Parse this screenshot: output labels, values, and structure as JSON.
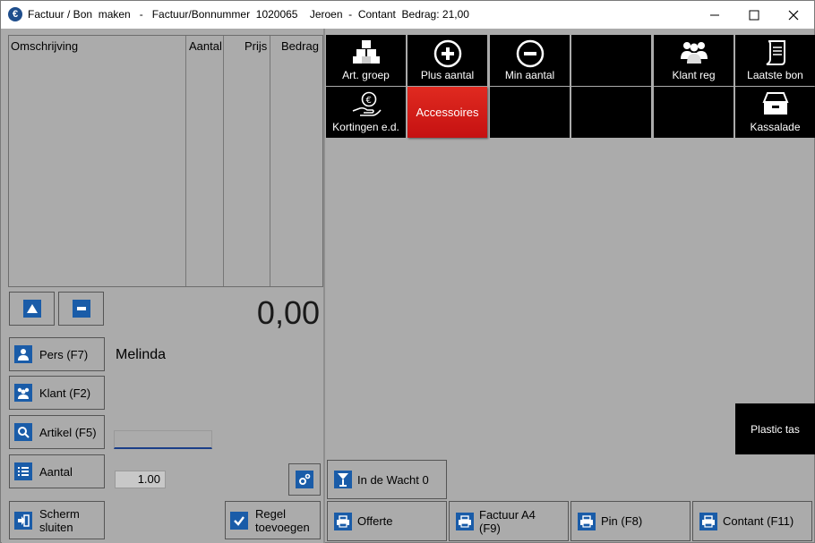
{
  "window": {
    "title": "Factuur / Bon  maken   -   Factuur/Bonnummer  1020065    Jeroen  -  Contant  Bedrag: 21,00"
  },
  "grid": {
    "headers": [
      "Omschrijving",
      "Aantal",
      "Prijs",
      "Bedrag"
    ]
  },
  "total": "0,00",
  "left_buttons": {
    "pers": "Pers (F7)",
    "klant": "Klant (F2)",
    "artikel": "Artikel (F5)",
    "aantal": "Aantal",
    "scherm_1": "Scherm",
    "scherm_2": "sluiten",
    "regel_1": "Regel",
    "regel_2": "toevoegen"
  },
  "person_name": "Melinda",
  "artikel_value": "",
  "aantal_value": "1.00",
  "tiles": {
    "art_groep": "Art. groep",
    "plus_aantal": "Plus aantal",
    "min_aantal": "Min aantal",
    "klant_reg": "Klant reg",
    "laatste_bon": "Laatste bon",
    "kortingen": "Kortingen e.d.",
    "accessoires": "Accessoires",
    "kassalade": "Kassalade",
    "plastic_tas": "Plastic tas"
  },
  "bottom_buttons": {
    "in_de_wacht": "In de Wacht 0",
    "offerte": "Offerte",
    "factuur_1": "Factuur A4",
    "factuur_2": "(F9)",
    "pin": "Pin (F8)",
    "contant": "Contant (F11)"
  },
  "colors": {
    "accent_blue": "#1a5ca8",
    "tile_black": "#000000",
    "tile_red": "#d81f1f",
    "background": "#ababab"
  }
}
